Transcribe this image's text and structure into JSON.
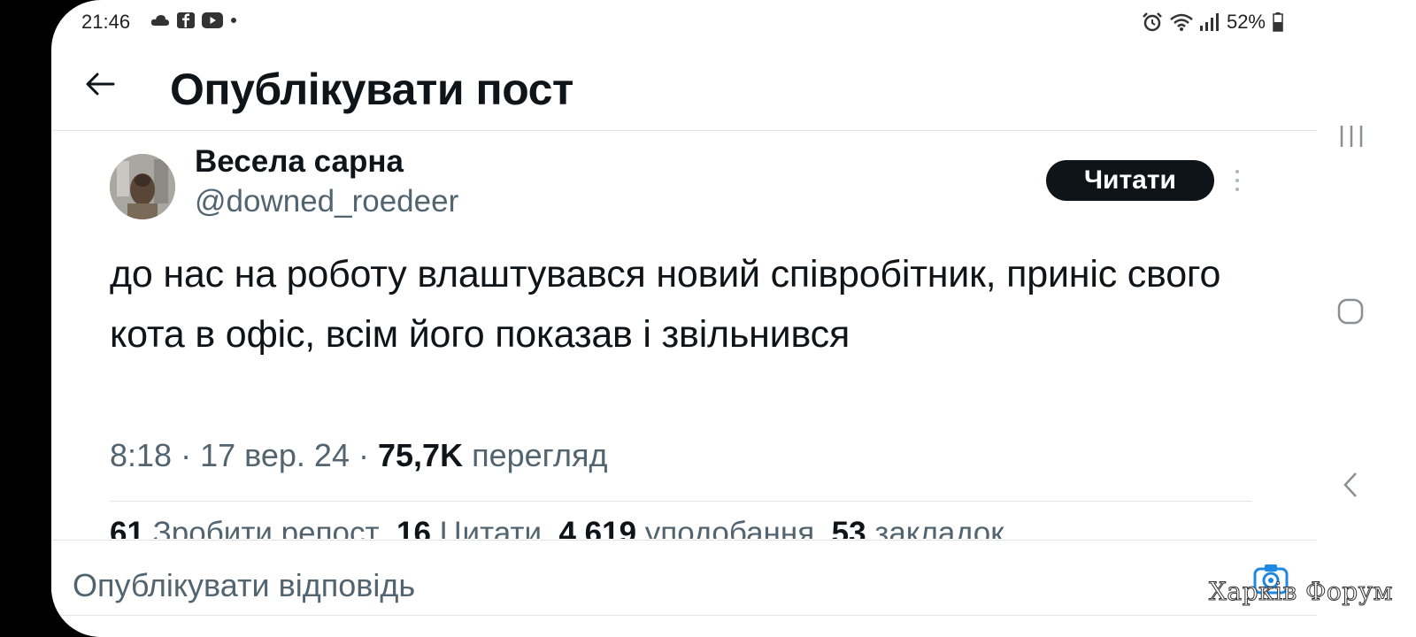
{
  "status_bar": {
    "time": "21:46",
    "battery": "52%",
    "notification_icons": [
      "cloud-icon",
      "facebook-icon",
      "youtube-icon",
      "dot-icon"
    ],
    "right_icons": [
      "alarm-icon",
      "wifi-icon",
      "signal-icon",
      "battery-icon"
    ]
  },
  "header": {
    "title": "Опублікувати пост",
    "back_icon": "back-arrow-icon"
  },
  "post": {
    "display_name": "Весела сарна",
    "handle": "@downed_roedeer",
    "follow_label": "Читати",
    "text": "до нас на роботу влаштувався новий співробітник, приніс свого кота в офіс, всім його показав і звільнився",
    "time": "8:18",
    "date": "17 вер. 24",
    "views_count": "75,7K",
    "views_label": "перегляд",
    "separator": "·"
  },
  "stats": {
    "reposts_count": "61",
    "reposts_label": "Зробити репост",
    "quotes_count": "16",
    "quotes_label": "Цитати",
    "likes_count": "4 619",
    "likes_label": "уподобання",
    "bookmarks_count": "53",
    "bookmarks_label": "закладок"
  },
  "reply": {
    "placeholder": "Опублікувати відповідь"
  },
  "watermark": {
    "text": "Харків Форум"
  },
  "system_nav": [
    "recent-apps-icon",
    "home-icon",
    "back-icon"
  ],
  "colors": {
    "text_primary": "#0f1419",
    "text_secondary": "#536471",
    "button_bg": "#0f1419",
    "button_text": "#ffffff",
    "divider": "#e3e6e8"
  }
}
